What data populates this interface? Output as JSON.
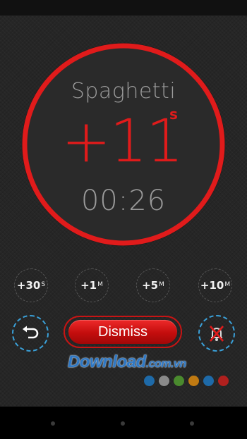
{
  "timer": {
    "name": "Spaghetti",
    "overtime": "+11",
    "overtime_unit": "s",
    "elapsed": "00:26"
  },
  "add_time": [
    {
      "value": "+30",
      "unit": "S"
    },
    {
      "value": "+1",
      "unit": "M"
    },
    {
      "value": "+5",
      "unit": "M"
    },
    {
      "value": "+10",
      "unit": "M"
    }
  ],
  "actions": {
    "reset_icon": "undo-arrow-icon",
    "dismiss_label": "Dismiss",
    "mute_icon": "muted-bell-icon"
  },
  "watermark": {
    "brand": "Download",
    "domain": ".com.vn",
    "dot_colors": [
      "#1e6aa8",
      "#8a8a8a",
      "#4a8a2e",
      "#c07a12",
      "#1e6aa8",
      "#b0201e"
    ]
  },
  "colors": {
    "accent_red": "#e01b1b",
    "accent_blue": "#3aa0d8"
  },
  "navigation": {
    "items": [
      "back-icon",
      "home-icon",
      "recents-icon"
    ]
  }
}
